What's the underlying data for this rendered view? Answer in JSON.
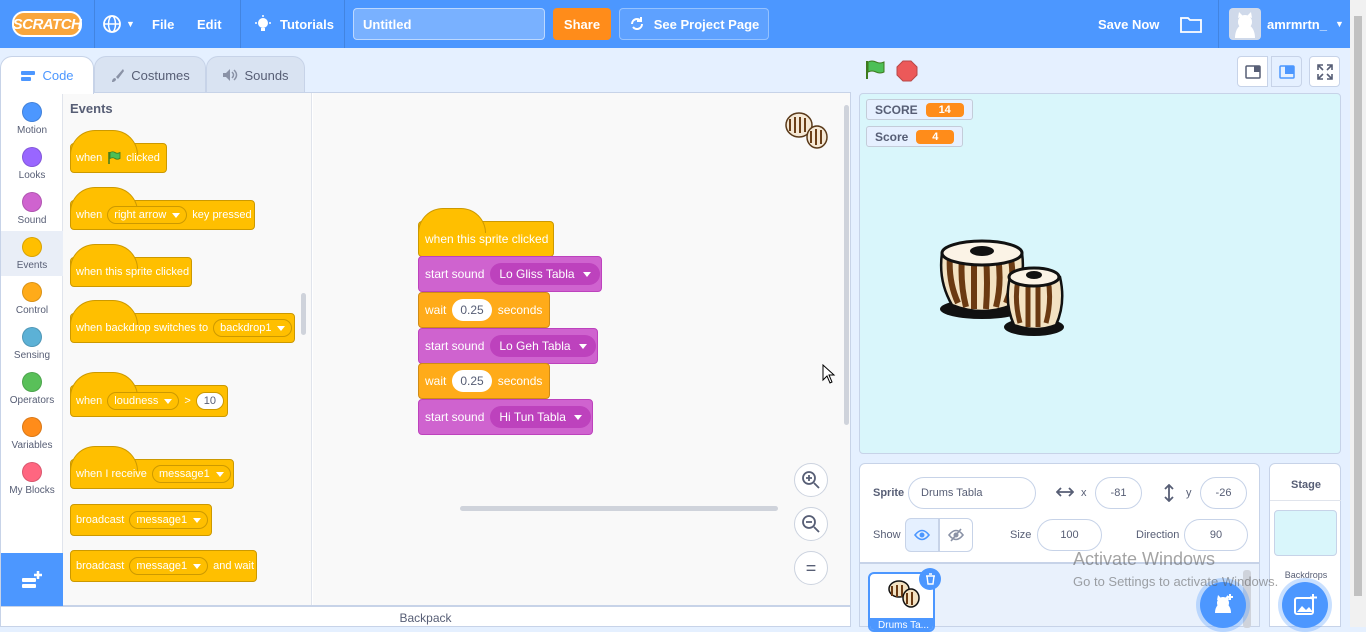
{
  "menubar": {
    "logo": "SCRATCH",
    "file": "File",
    "edit": "Edit",
    "tutorials": "Tutorials",
    "project_title": "Untitled",
    "share": "Share",
    "see_project_page": "See Project Page",
    "save_now": "Save Now",
    "username": "amrmrtn_"
  },
  "tabs": {
    "code": "Code",
    "costumes": "Costumes",
    "sounds": "Sounds"
  },
  "categories": [
    {
      "label": "Motion",
      "color": "#4c97ff"
    },
    {
      "label": "Looks",
      "color": "#9966ff"
    },
    {
      "label": "Sound",
      "color": "#cf63cf"
    },
    {
      "label": "Events",
      "color": "#ffbf00"
    },
    {
      "label": "Control",
      "color": "#ffab19"
    },
    {
      "label": "Sensing",
      "color": "#5cb1d6"
    },
    {
      "label": "Operators",
      "color": "#59c059"
    },
    {
      "label": "Variables",
      "color": "#ff8c1a"
    },
    {
      "label": "My Blocks",
      "color": "#ff6680"
    }
  ],
  "palette": {
    "title": "Events",
    "flag_clicked": {
      "when": "when",
      "clicked": "clicked"
    },
    "key_pressed": {
      "when": "when",
      "key": "right arrow",
      "pressed": "key pressed"
    },
    "sprite_clicked": "when this sprite clicked",
    "backdrop_switch": {
      "text": "when backdrop switches to",
      "value": "backdrop1"
    },
    "loudness": {
      "when": "when",
      "sensor": "loudness",
      "op": ">",
      "value": "10"
    },
    "receive": {
      "text": "when I receive",
      "value": "message1"
    },
    "broadcast": {
      "text": "broadcast",
      "value": "message1"
    },
    "broadcast_wait": {
      "text": "broadcast",
      "value": "message1",
      "suffix": "and wait"
    }
  },
  "script": {
    "hat": "when this sprite clicked",
    "s1": {
      "text": "start sound",
      "value": "Lo Gliss Tabla"
    },
    "w1": {
      "text": "wait",
      "value": "0.25",
      "suffix": "seconds"
    },
    "s2": {
      "text": "start sound",
      "value": "Lo Geh Tabla"
    },
    "w2": {
      "text": "wait",
      "value": "0.25",
      "suffix": "seconds"
    },
    "s3": {
      "text": "start sound",
      "value": "Hi Tun Tabla"
    }
  },
  "zoom": {
    "reset": "="
  },
  "backpack": "Backpack",
  "monitors": [
    {
      "label": "SCORE",
      "value": "14"
    },
    {
      "label": "Score",
      "value": "4"
    }
  ],
  "sprite_info": {
    "sprite_label": "Sprite",
    "sprite_name": "Drums Tabla",
    "x_label": "x",
    "x": "-81",
    "y_label": "y",
    "y": "-26",
    "show_label": "Show",
    "size_label": "Size",
    "size": "100",
    "direction_label": "Direction",
    "direction": "90"
  },
  "sprite_tile": "Drums Ta...",
  "stage_panel": {
    "title": "Stage",
    "backdrops": "Backdrops"
  },
  "watermark": {
    "line1": "Activate Windows",
    "line2": "Go to Settings to activate Windows."
  }
}
